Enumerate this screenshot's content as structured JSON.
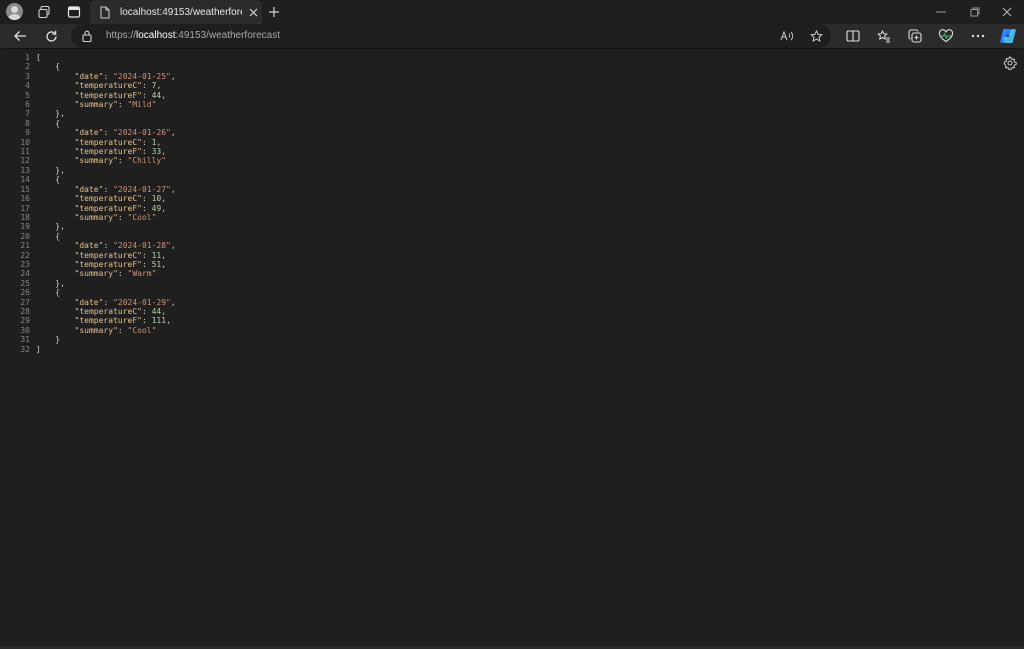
{
  "tab": {
    "title": "localhost:49153/weatherforecast"
  },
  "address": {
    "scheme": "https://",
    "host": "localhost",
    "rest": ":49153/weatherforecast"
  },
  "icons": {
    "profile": "avatar-icon",
    "workspaces": "workspaces-icon",
    "tab_actions": "tab-actions-icon",
    "page": "page-icon",
    "close": "close-icon",
    "new_tab": "plus-icon",
    "back": "back-arrow-icon",
    "refresh": "refresh-icon",
    "lock": "lock-icon",
    "read_aloud": "read-aloud-icon",
    "favorite": "star-icon",
    "split": "split-screen-icon",
    "favorites": "favorites-icon",
    "collections": "collections-icon",
    "health": "heart-pulse-icon",
    "more": "more-icon",
    "copilot": "copilot-icon",
    "settings": "gear-icon"
  },
  "forecast": [
    {
      "date": "2024-01-25",
      "temperatureC": "7",
      "temperatureF": "44",
      "summary": "Mild"
    },
    {
      "date": "2024-01-26",
      "temperatureC": "1",
      "temperatureF": "33",
      "summary": "Chilly"
    },
    {
      "date": "2024-01-27",
      "temperatureC": "10",
      "temperatureF": "49",
      "summary": "Cool"
    },
    {
      "date": "2024-01-28",
      "temperatureC": "11",
      "temperatureF": "51",
      "summary": "Warm"
    },
    {
      "date": "2024-01-29",
      "temperatureC": "44",
      "temperatureF": "111",
      "summary": "Cool"
    }
  ],
  "line_count": 32,
  "colors": {
    "key": "#e2c08d",
    "string": "#ce9178",
    "number": "#b5cea8",
    "background": "#1f1f1f"
  }
}
